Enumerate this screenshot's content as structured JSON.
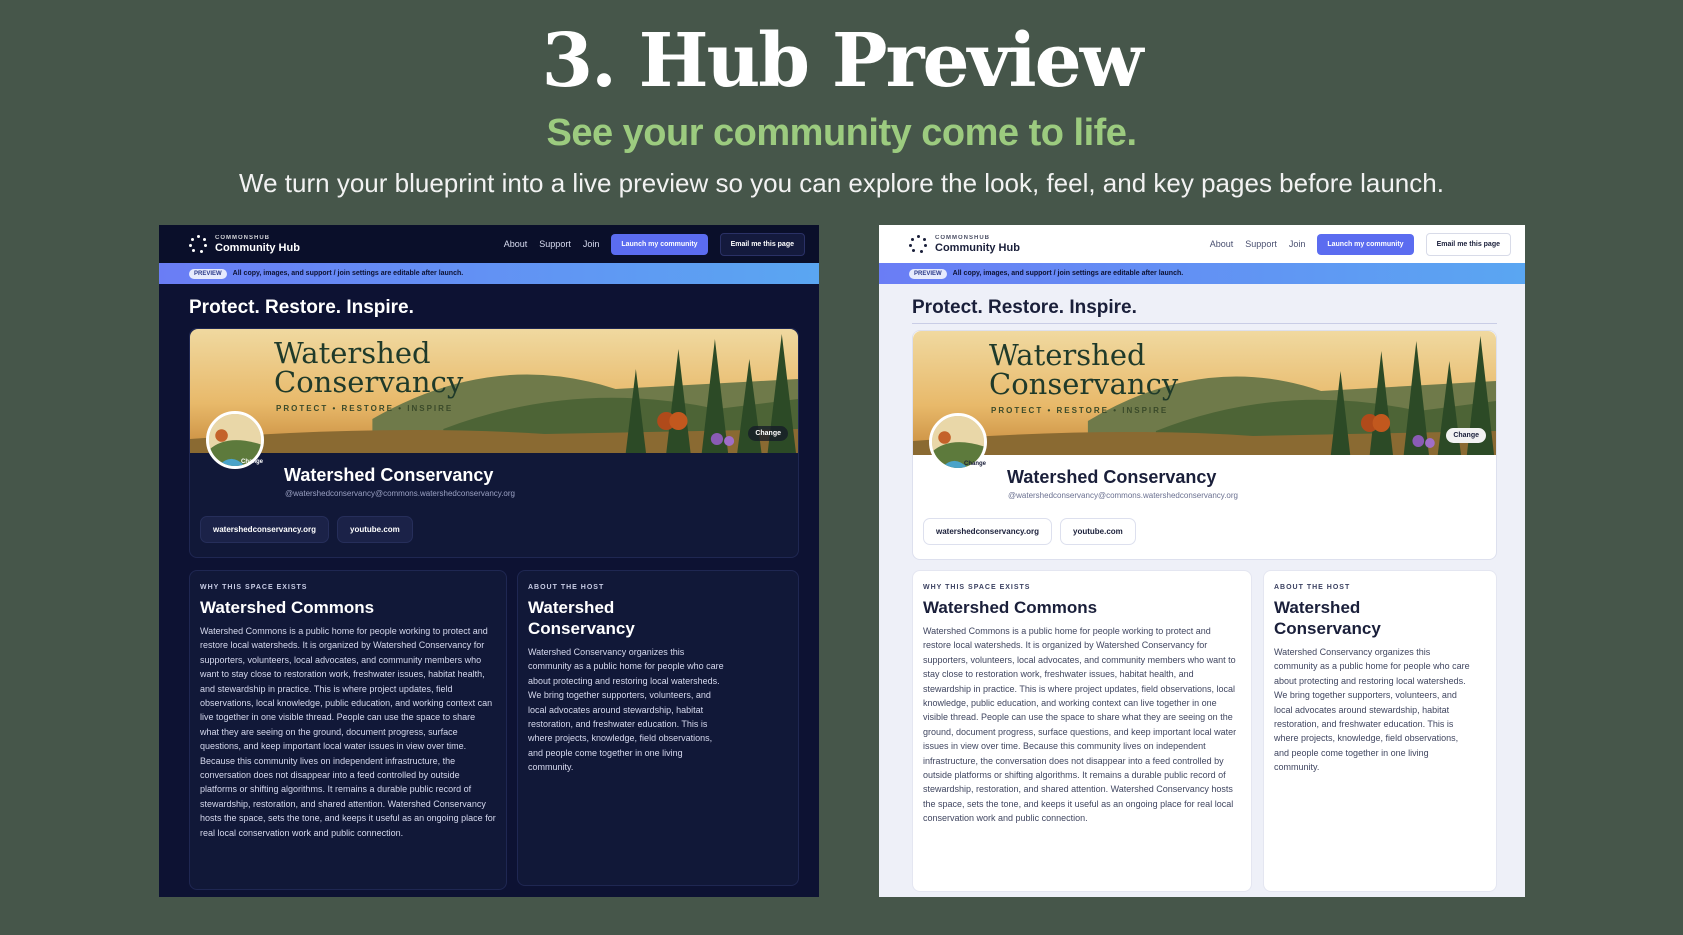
{
  "slide": {
    "title": "3. Hub Preview",
    "subtitle": "See your community come to life.",
    "description": "We turn your blueprint into a live preview so you can explore the look, feel, and key pages before launch."
  },
  "hub": {
    "brand_small": "COMMONSHUB",
    "brand_name": "Community Hub",
    "nav": [
      "About",
      "Support",
      "Join"
    ],
    "launch_button": "Launch my community",
    "email_button": "Email me this page",
    "preview_pill": "PREVIEW",
    "preview_note": "All copy, images, and support / join settings are editable after launch.",
    "headline": "Protect. Restore. Inspire.",
    "banner_title_line1": "Watershed",
    "banner_title_line2": "Conservancy",
    "banner_tagline": "PROTECT • RESTORE • INSPIRE",
    "banner_change": "Change",
    "avatar_change": "Change",
    "org_name": "Watershed Conservancy",
    "org_handle": "@watershedconservancy@commons.watershedconservancy.org",
    "links": [
      "watershedconservancy.org",
      "youtube.com"
    ],
    "why": {
      "eyebrow": "WHY THIS SPACE EXISTS",
      "title": "Watershed Commons",
      "body": "Watershed Commons is a public home for people working to protect and restore local watersheds. It is organized by Watershed Conservancy for supporters, volunteers, local advocates, and community members who want to stay close to restoration work, freshwater issues, habitat health, and stewardship in practice. This is where project updates, field observations, local knowledge, public education, and working context can live together in one visible thread. People can use the space to share what they are seeing on the ground, document progress, surface questions, and keep important local water issues in view over time. Because this community lives on independent infrastructure, the conversation does not disappear into a feed controlled by outside platforms or shifting algorithms. It remains a durable public record of stewardship, restoration, and shared attention. Watershed Conservancy hosts the space, sets the tone, and keeps it useful as an ongoing place for real local conservation work and public connection."
    },
    "host": {
      "eyebrow": "ABOUT THE HOST",
      "title": "Watershed Conservancy",
      "body": "Watershed Conservancy organizes this community as a public home for people who care about protecting and restoring local watersheds. We bring together supporters, volunteers, and local advocates around stewardship, habitat restoration, and freshwater education. This is where projects, knowledge, field observations, and people come together in one living community."
    }
  },
  "colors": {
    "background": "#46564a",
    "subtitle": "#9ccb7f",
    "accent": "#5b6cf0",
    "dark_theme_bg": "#0d1233",
    "light_theme_bg": "#eef0f8"
  }
}
